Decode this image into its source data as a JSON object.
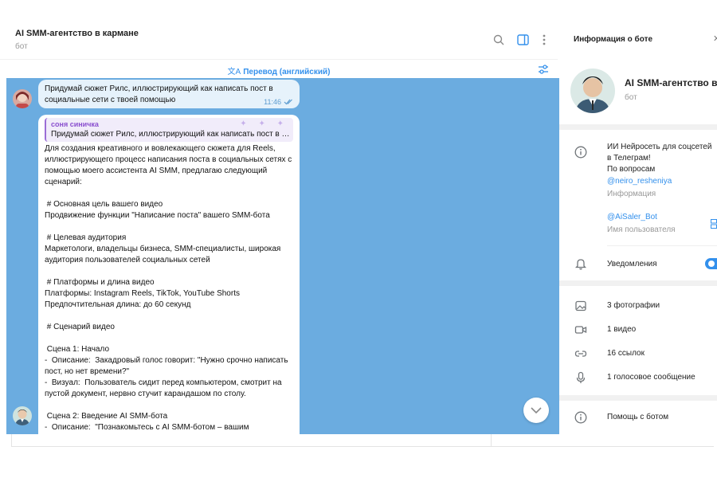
{
  "header": {
    "title": "AI SMM-агентство в кармане",
    "status": "бот"
  },
  "translate_bar": {
    "glyph": "文A",
    "label": "Перевод (английский)"
  },
  "messages": {
    "outgoing": {
      "text": "Придумай сюжет Рилс, иллюстрирующий как написать пост в социальные сети с твоей помощью",
      "time": "11:46"
    },
    "incoming": {
      "reply_name": "соня синичка",
      "reply_text": "Придумай сюжет Рилс, иллюстрирующий как написать пост в социальные сети с твоей помощью",
      "reply_decoration": "✦ ✦ ✦",
      "body": "Для создания креативного и вовлекающего сюжета для Reels, иллюстрирующего процесс написания поста в социальных сетях с помощью моего ассистента AI SMM, предлагаю следующий сценарий:\n\n # Основная цель вашего видео\nПродвижение функции \"Написание поста\" вашего SMM-бота\n\n # Целевая аудитория\nМаркетологи, владельцы бизнеса, SMM-специалисты, широкая аудитория пользователей социальных сетей\n\n # Платформы и длина видео\nПлатформы: Instagram Reels, TikTok, YouTube Shorts\nПредпочтительная длина: до 60 секунд\n\n # Сценарий видео\n\n Сцена 1: Начало\n-  Описание:  Закадровый голос говорит: \"Нужно срочно написать пост, но нет времени?\"\n-  Визуал:  Пользователь сидит перед компьютером, смотрит на пустой документ, нервно стучит карандашом по столу.\n\n Сцена 2: Введение AI SMM-бота\n-  Описание:  \"Познакомьтесь с AI SMM-ботом – вашим"
    }
  },
  "info_panel": {
    "title": "Информация о боте",
    "close_glyph": "✕",
    "bot_name": "AI SMM-агентство в кармане",
    "bot_status": "бот",
    "description": "ИИ Нейросеть для соцсетей в Телеграм!\nПо вопросам",
    "description_link": "@neiro_resheniya",
    "description_sub": "Информация",
    "username": "@AiSaler_Bot",
    "username_sub": "Имя пользователя",
    "notifications_label": "Уведомления",
    "notifications_on": true,
    "media": [
      {
        "icon": "photo-icon",
        "label": "3 фотографии"
      },
      {
        "icon": "video-icon",
        "label": "1 видео"
      },
      {
        "icon": "link-icon",
        "label": "16 ссылок"
      },
      {
        "icon": "microphone-icon",
        "label": "1 голосовое сообщение"
      }
    ],
    "help_label": "Помощь с ботом"
  },
  "colors": {
    "accent": "#3390ec",
    "chat_background": "#6bace0",
    "outgoing_bubble": "#e6f2fb",
    "reply_accent": "#9b6dd6"
  }
}
